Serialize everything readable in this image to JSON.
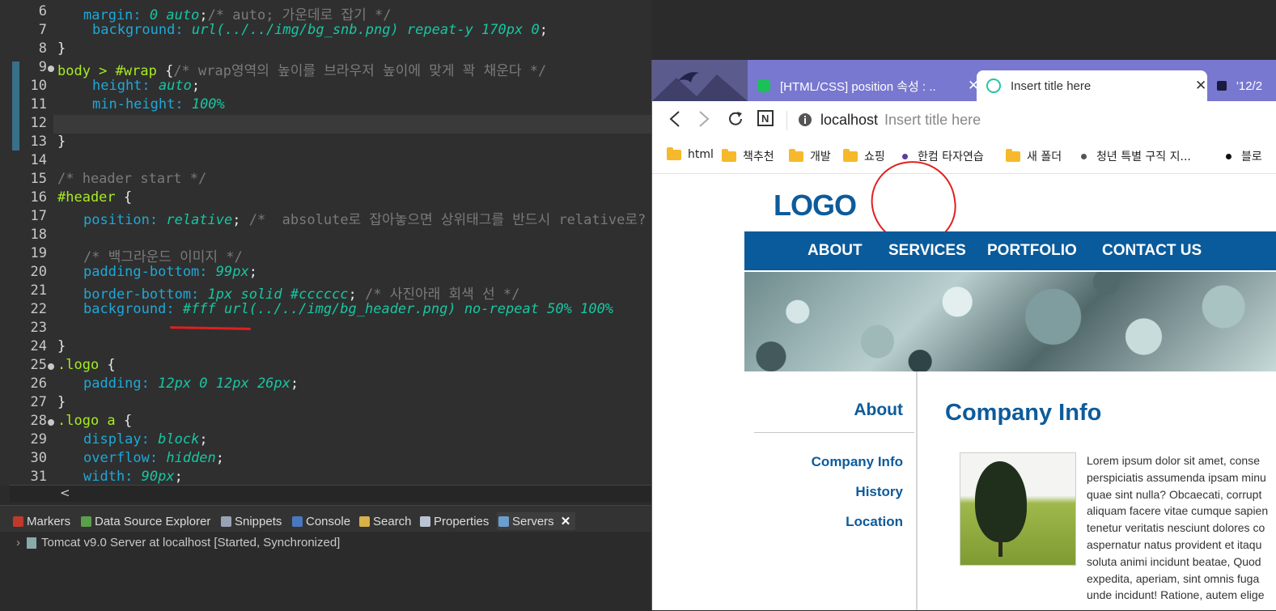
{
  "editor": {
    "line_numbers": [
      "6",
      "7",
      "8",
      "9",
      "10",
      "11",
      "12",
      "13",
      "14",
      "15",
      "16",
      "17",
      "18",
      "19",
      "20",
      "21",
      "22",
      "23",
      "24",
      "25",
      "26",
      "27",
      "28",
      "29",
      "30",
      "31"
    ],
    "lines": {
      "l6": {
        "prop": "margin:",
        "val": " 0 auto",
        "rest": ";",
        "cm": "/* auto; 가운데로 잡기 */"
      },
      "l7": {
        "prop": "background:",
        "val": " url(../../img/bg_snb.png) repeat-y 170px 0",
        "rest": ";"
      },
      "l8": {
        "brace": "}"
      },
      "l9": {
        "sel": "body > #wrap",
        "brace": " {",
        "cm": "/* wrap영역의 높이를 브라우저 높이에 맞게 꽉 채운다 */"
      },
      "l10": {
        "prop": "height:",
        "val": " auto",
        "rest": ";"
      },
      "l11": {
        "prop": "min-height:",
        "val": " 100%"
      },
      "l13": {
        "brace": "}"
      },
      "l15": {
        "cm": "/* header start */"
      },
      "l16": {
        "sel": "#header",
        "brace": " {"
      },
      "l17": {
        "prop": "position:",
        "val": " relative",
        "rest": "; ",
        "cm": "/*  absolute로 잡아놓으면 상위태그를 반드시 relative로?"
      },
      "l19": {
        "cm": "/* 백그라운드 이미지 */"
      },
      "l20": {
        "prop": "padding-bottom:",
        "val": " 99px",
        "rest": ";"
      },
      "l21": {
        "prop": "border-bottom:",
        "val": " 1px solid #cccccc",
        "rest": "; ",
        "cm": "/* 사진아래 회색 선 */"
      },
      "l22": {
        "prop": "background:",
        "val": " #fff url(../../img/bg_header.png) no-repeat 50% 100%"
      },
      "l24": {
        "brace": "}"
      },
      "l25": {
        "sel": ".logo",
        "brace": " {"
      },
      "l26": {
        "prop": "padding:",
        "val": " 12px 0 12px 26px",
        "rest": ";"
      },
      "l27": {
        "brace": "}"
      },
      "l28": {
        "sel": ".logo a",
        "brace": " {"
      },
      "l29": {
        "prop": "display:",
        "val": " block",
        "rest": ";"
      },
      "l30": {
        "prop": "overflow:",
        "val": " hidden",
        "rest": ";"
      },
      "l31": {
        "prop": "width:",
        "val": " 90px",
        "rest": ";"
      }
    },
    "scroll_arrow": "<"
  },
  "panel": {
    "tabs": [
      "Markers",
      "Data Source Explorer",
      "Snippets",
      "Console",
      "Search",
      "Properties",
      "Servers"
    ],
    "close": "✕",
    "server_chevron": "›",
    "server_row": "Tomcat v9.0 Server at localhost  [Started, Synchronized]"
  },
  "browser": {
    "tabs": [
      {
        "title": "[HTML/CSS] position 속성 : ..",
        "close": "✕"
      },
      {
        "title": "Insert title here",
        "close": "✕"
      },
      {
        "title": "'12/2"
      }
    ],
    "address_host": "localhost",
    "address_title": "Insert title here",
    "bookmarks": [
      "html",
      "책추천",
      "개발",
      "쇼핑",
      "한컴 타자연습",
      "새 폴더",
      "청년 특별 구직 지...",
      "블로"
    ],
    "page": {
      "logo": "LOGO",
      "menu": [
        "ABOUT",
        "SERVICES",
        "PORTFOLIO",
        "CONTACT US"
      ],
      "lnb_title": "About",
      "lnb_items": [
        "Company Info",
        "History",
        "Location"
      ],
      "content_title": "Company Info",
      "lorem_lines": [
        "Lorem ipsum dolor sit amet, conse",
        "perspiciatis assumenda ipsam minu",
        "quae sint nulla? Obcaecati, corrupt",
        "aliquam facere vitae cumque sapien",
        "tenetur veritatis nesciunt dolores co",
        "aspernatur natus provident et itaqu",
        "soluta animi incidunt beatae, Quod",
        "expedita, aperiam, sint omnis fuga",
        "unde incidunt! Ratione, autem elige"
      ]
    }
  },
  "colors": {
    "brand_blue": "#0a5b9b",
    "tab_strip": "#7878d0",
    "annotation_red": "#e02020"
  }
}
